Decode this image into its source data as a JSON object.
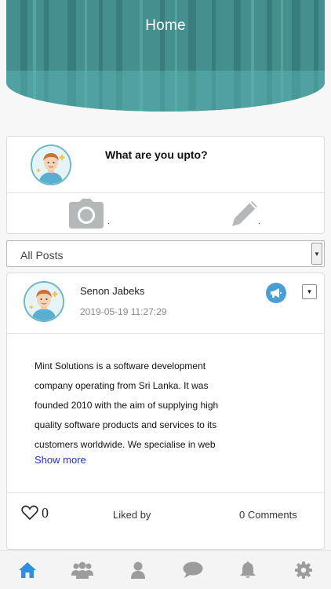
{
  "header": {
    "title": "Home"
  },
  "compose": {
    "prompt": "What are you upto?",
    "photo_icon": "camera-icon",
    "write_icon": "pencil-icon",
    "photo_dot": ".",
    "write_dot": "."
  },
  "filter": {
    "selected": "All Posts"
  },
  "post": {
    "author": "Senon Jabeks",
    "timestamp": "2019-05-19 11:27:29",
    "type_icon": "megaphone-icon",
    "body": "Mint Solutions is a software development company operating from Sri Lanka. It was founded 2010 with the aim of supplying high quality software products and services to its customers worldwide. We specialise in web",
    "show_more": "Show more",
    "like_count": "0",
    "liked_by": "Liked by",
    "comments": "0 Comments"
  },
  "tabbar": {
    "items": [
      {
        "name": "home",
        "icon": "home-icon",
        "active": true
      },
      {
        "name": "groups",
        "icon": "group-icon",
        "active": false
      },
      {
        "name": "profile",
        "icon": "person-icon",
        "active": false
      },
      {
        "name": "messages",
        "icon": "chat-icon",
        "active": false
      },
      {
        "name": "notifications",
        "icon": "bell-icon",
        "active": false
      },
      {
        "name": "settings",
        "icon": "gear-icon",
        "active": false
      }
    ]
  },
  "colors": {
    "accent": "#2f8fe0",
    "tab_inactive": "#9c9c9c",
    "link": "#2230c9",
    "avatar_ring": "#6cb8c3"
  }
}
